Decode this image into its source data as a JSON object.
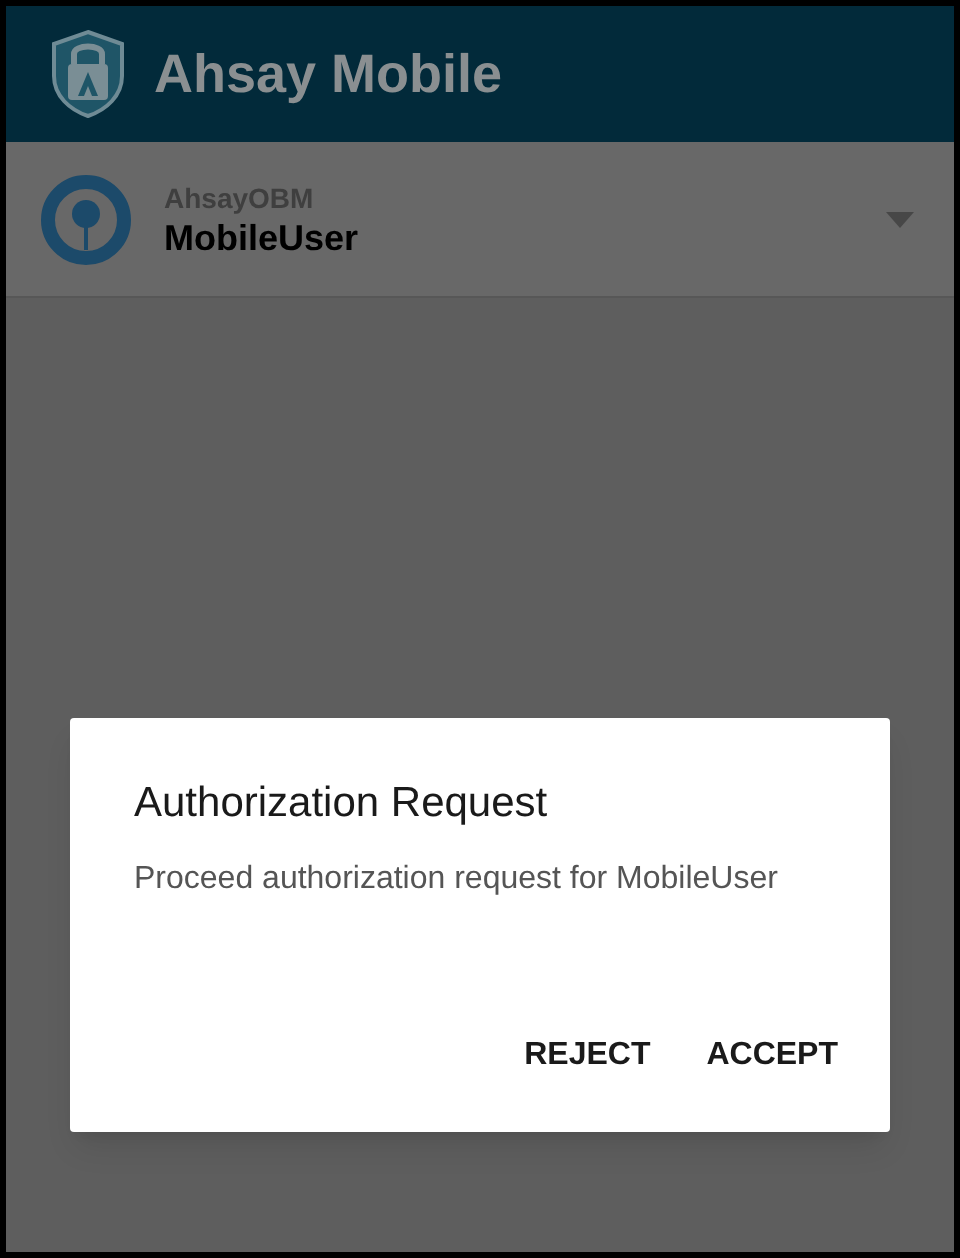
{
  "app_bar": {
    "title": "Ahsay Mobile"
  },
  "account": {
    "server": "AhsayOBM",
    "user": "MobileUser"
  },
  "dialog": {
    "title": "Authorization Request",
    "message": "Proceed authorization request for MobileUser",
    "buttons": [
      {
        "label": "REJECT"
      },
      {
        "label": "ACCEPT"
      }
    ]
  }
}
